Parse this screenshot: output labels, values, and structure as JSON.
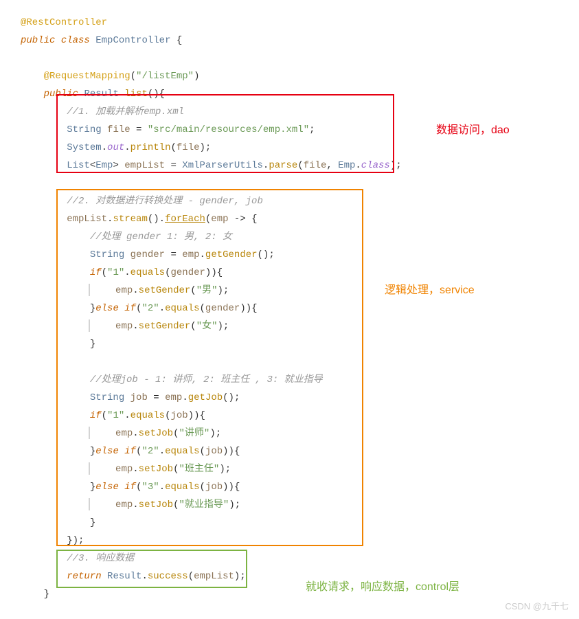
{
  "code": {
    "l1": "@RestController",
    "l2_public": "public",
    "l2_class": "class",
    "l2_name": "EmpController",
    "l2_brace": " {",
    "l4_anno": "@RequestMapping",
    "l4_paren_o": "(",
    "l4_str": "\"/listEmp\"",
    "l4_paren_c": ")",
    "l5_public": "public",
    "l5_type": "Result",
    "l5_method": "list",
    "l5_parens": "(){",
    "l6_comment": "//1. 加载并解析emp.xml",
    "l7_type": "String",
    "l7_var": "file",
    "l7_eq": " = ",
    "l7_str": "\"src/main/resources/emp.xml\"",
    "l7_semi": ";",
    "l8_sys": "System",
    "l8_dot": ".",
    "l8_out": "out",
    "l8_println": "println",
    "l8_po": "(",
    "l8_arg": "file",
    "l8_pc": ");",
    "l9_list": "List",
    "l9_lt": "<",
    "l9_emp": "Emp",
    "l9_gt": ">",
    "l9_var": " empList",
    "l9_eq": " = ",
    "l9_cls": "XmlParserUtils",
    "l9_parse": "parse",
    "l9_po": "(",
    "l9_a1": "file",
    "l9_comma": ", ",
    "l9_a2": "Emp",
    "l9_class": "class",
    "l9_pc": ");",
    "l11_comment": "//2. 对数据进行转换处理 - gender, job",
    "l12_var": "empList",
    "l12_stream": "stream",
    "l12_foreach": "forEach",
    "l12_arg": "emp",
    "l12_arrow": " -> {",
    "l13_comment": "//处理 gender 1: 男, 2: 女",
    "l14_type": "String",
    "l14_var": "gender",
    "l14_eq": " = ",
    "l14_emp": "emp",
    "l14_get": "getGender",
    "l14_pc": "();",
    "l15_if": "if",
    "l15_po": "(",
    "l15_str": "\"1\"",
    "l15_eq": "equals",
    "l15_arg": "gender",
    "l15_pc": ")){",
    "l16_emp": "emp",
    "l16_set": "setGender",
    "l16_str": "\"男\"",
    "l16_pc": ");",
    "l17_else": "else",
    "l17_if": "if",
    "l17_str": "\"2\"",
    "l17_eq": "equals",
    "l17_arg": "gender",
    "l17_pc": ")){",
    "l18_emp": "emp",
    "l18_set": "setGender",
    "l18_str": "\"女\"",
    "l18_pc": ");",
    "l19_brace": "}",
    "l21_comment": "//处理job - 1: 讲师, 2: 班主任 , 3: 就业指导",
    "l22_type": "String",
    "l22_var": "job",
    "l22_emp": "emp",
    "l22_get": "getJob",
    "l22_pc": "();",
    "l23_if": "if",
    "l23_str": "\"1\"",
    "l23_eq": "equals",
    "l23_arg": "job",
    "l23_pc": ")){",
    "l24_emp": "emp",
    "l24_set": "setJob",
    "l24_str": "\"讲师\"",
    "l24_pc": ");",
    "l25_else": "else",
    "l25_if": "if",
    "l25_str": "\"2\"",
    "l25_eq": "equals",
    "l25_arg": "job",
    "l25_pc": ")){",
    "l26_emp": "emp",
    "l26_set": "setJob",
    "l26_str": "\"班主任\"",
    "l26_pc": ");",
    "l27_else": "else",
    "l27_if": "if",
    "l27_str": "\"3\"",
    "l27_eq": "equals",
    "l27_arg": "job",
    "l27_pc": ")){",
    "l28_emp": "emp",
    "l28_set": "setJob",
    "l28_str": "\"就业指导\"",
    "l28_pc": ");",
    "l29_brace": "}",
    "l30_close": "});",
    "l31_comment": "//3. 响应数据",
    "l32_return": "return",
    "l32_cls": "Result",
    "l32_succ": "success",
    "l32_arg": "empList",
    "l32_pc": ");",
    "l33_brace": "}"
  },
  "labels": {
    "dao": "数据访问，dao",
    "service": "逻辑处理，service",
    "control": "就收请求，响应数据，control层"
  },
  "watermark": "CSDN @九千七"
}
